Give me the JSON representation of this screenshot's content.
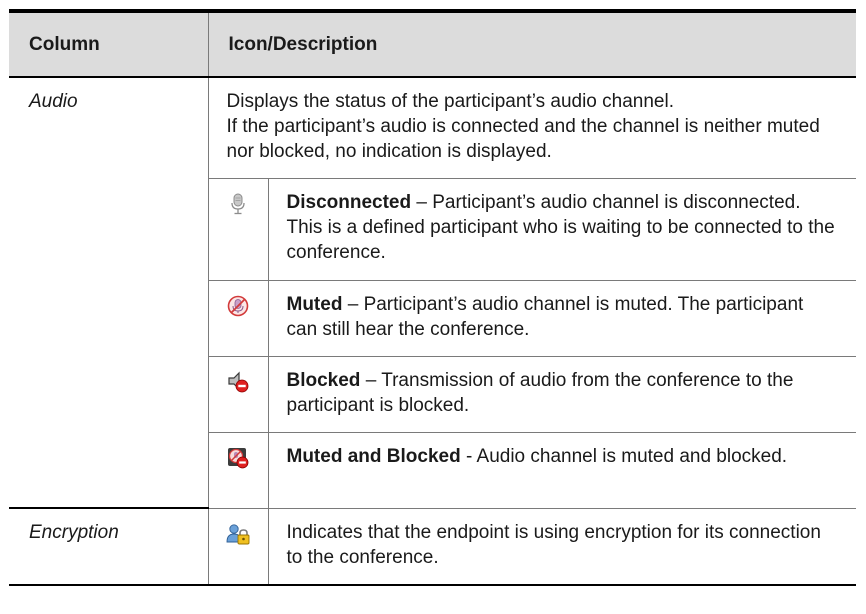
{
  "header": {
    "column": "Column",
    "description": "Icon/Description"
  },
  "rows": {
    "audio": {
      "name": "Audio",
      "intro_line1": "Displays the status of the participant’s audio channel.",
      "intro_line2": "If the participant’s audio is connected and the channel is neither muted nor blocked, no indication is displayed.",
      "items": [
        {
          "icon": "microphone-gray-icon",
          "title": "Disconnected",
          "separator": " – ",
          "text": "Participant’s audio channel is disconnected. This is a defined participant who is waiting to be connected to the conference."
        },
        {
          "icon": "microphone-muted-icon",
          "title": "Muted",
          "separator": " – ",
          "text": "Participant’s audio channel is muted. The participant can still hear the conference."
        },
        {
          "icon": "speaker-blocked-icon",
          "title": "Blocked",
          "separator": " – ",
          "text": "Transmission of audio from the conference to the participant is blocked."
        },
        {
          "icon": "muted-and-blocked-icon",
          "title": "Muted and Blocked",
          "separator": " - ",
          "text": "Audio channel is muted and blocked."
        }
      ]
    },
    "encryption": {
      "name": "Encryption",
      "icon": "user-lock-icon",
      "text": "Indicates that the endpoint is using encryption for its connection to the conference."
    }
  }
}
